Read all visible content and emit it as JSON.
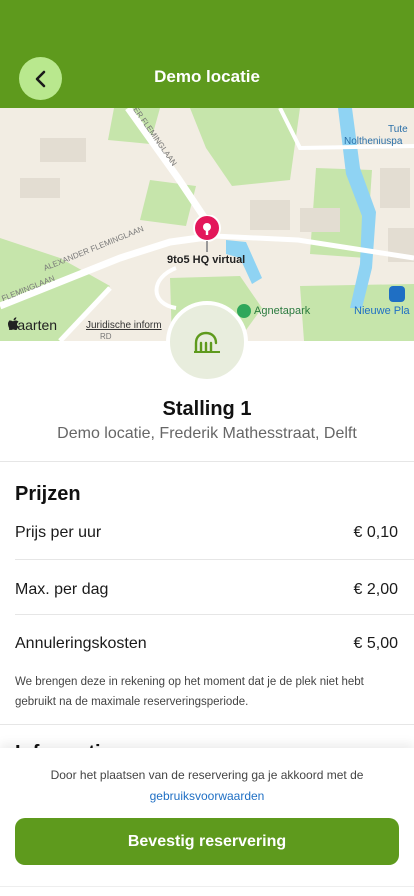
{
  "header": {
    "title": "Demo locatie",
    "back_icon": "chevron-left-icon"
  },
  "map": {
    "labels": {
      "top_right_1": "Tute",
      "top_right_2": "Noltheniuspa",
      "street_top": "ER FLEMINGLAAN",
      "street_mid": "ALEXANDER FLEMINGLAAN",
      "street_left": "FLEMINGLAAN",
      "street_bottom": "RD",
      "poi_pin": "9to5 HQ virtual",
      "park": "Agnetapark",
      "station": "Nieuwe Pla"
    },
    "attribution": "Kaarten",
    "legal": "Juridische inform",
    "colors": {
      "land": "#f2ede3",
      "green": "#c6e5ab",
      "water": "#8fd3f3",
      "pin": "#e3175a"
    }
  },
  "location": {
    "icon": "bike-rack-icon",
    "name": "Stalling 1",
    "address": "Demo locatie, Frederik Mathesstraat, Delft"
  },
  "prices": {
    "title": "Prijzen",
    "rows": [
      {
        "label": "Prijs per uur",
        "value": "€ 0,10"
      },
      {
        "label": "Max. per dag",
        "value": "€ 2,00"
      },
      {
        "label": "Annuleringskosten",
        "value": "€ 5,00"
      }
    ],
    "note": "We brengen deze in rekening op het moment dat je de plek niet hebt gebruikt na de maximale reserveringsperiode."
  },
  "next_section_title": "Informatie",
  "footer": {
    "terms_text": "Door het plaatsen van de reservering ga je akkoord met de",
    "terms_link": "gebruiksvoorwaarden",
    "confirm_label": "Bevestig reservering"
  },
  "colors": {
    "brand": "#5e9a1d",
    "accent_light": "#b9e88e",
    "link": "#1f6fc4"
  }
}
